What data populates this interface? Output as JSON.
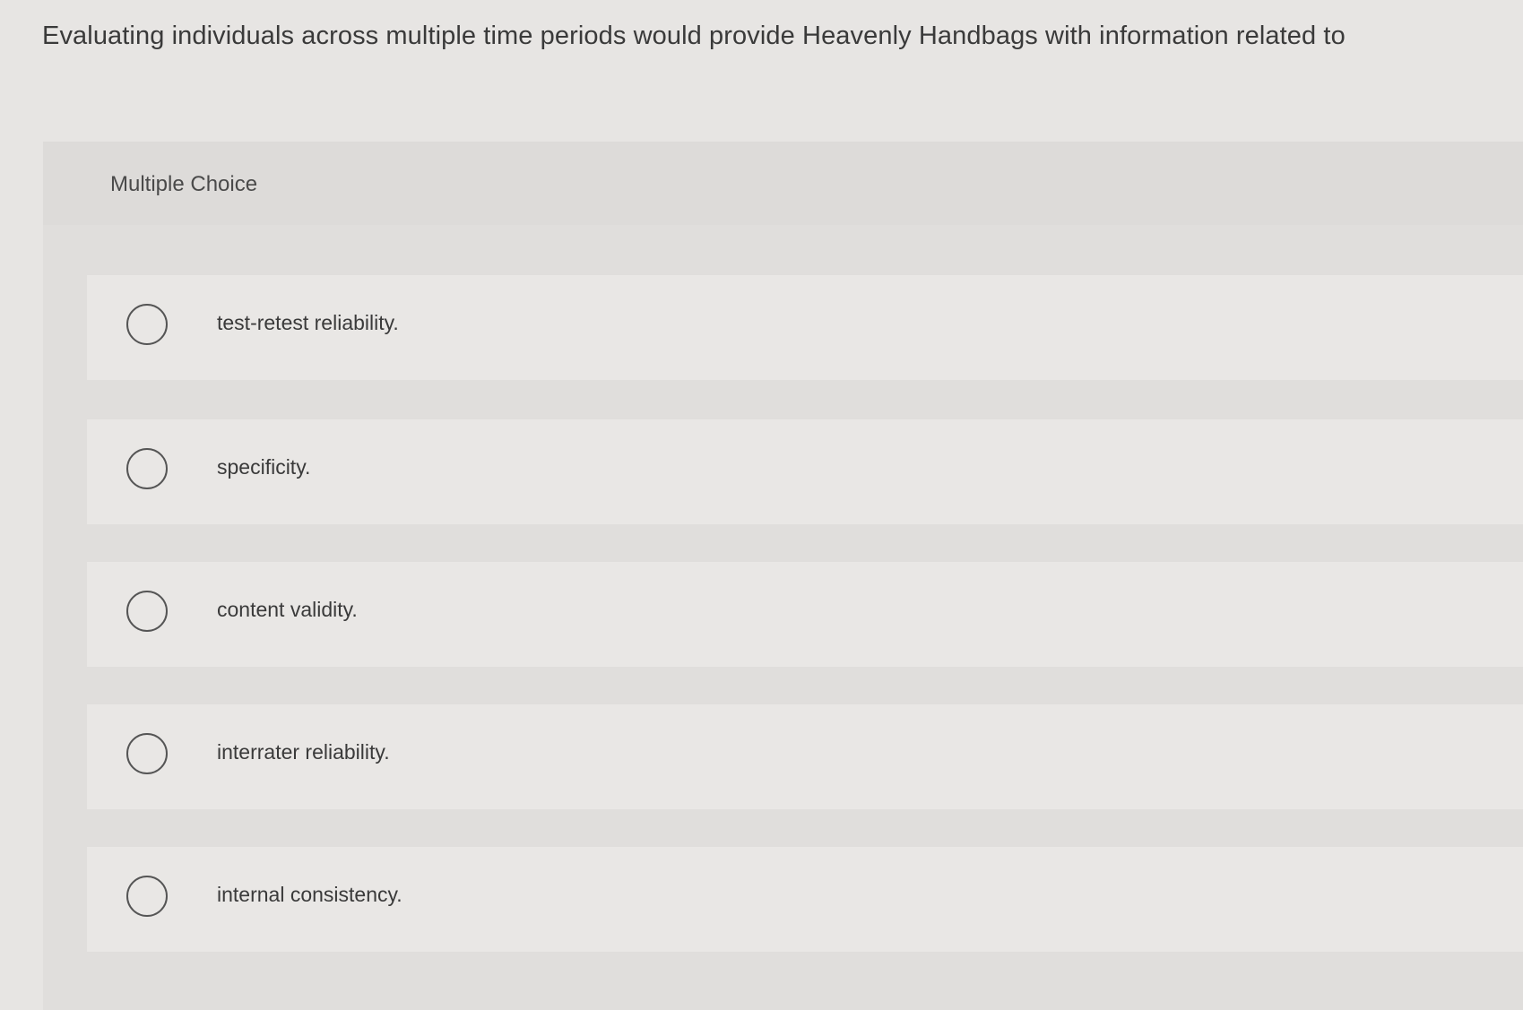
{
  "question": {
    "text": "Evaluating individuals across multiple time periods would provide Heavenly Handbags with information related to"
  },
  "multiple_choice": {
    "label": "Multiple Choice",
    "options": [
      {
        "label": "test-retest reliability.",
        "selected": false
      },
      {
        "label": "specificity.",
        "selected": false
      },
      {
        "label": "content validity.",
        "selected": false
      },
      {
        "label": "interrater reliability.",
        "selected": false
      },
      {
        "label": "internal consistency.",
        "selected": false
      }
    ]
  }
}
